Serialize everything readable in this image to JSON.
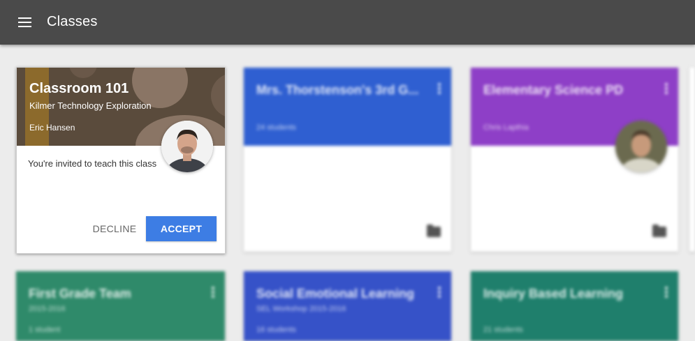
{
  "appbar": {
    "title": "Classes",
    "menu_icon": "hamburger-menu-icon"
  },
  "invite_card": {
    "title": "Classroom 101",
    "subtitle": "Kilmer Technology Exploration",
    "teacher": "Eric Hansen",
    "invite_text": "You're invited to teach this class",
    "decline_label": "DECLINE",
    "accept_label": "ACCEPT",
    "accent_color": "#3d7de4"
  },
  "classes": [
    {
      "title": "Mrs. Thorstenson's 3rd G...",
      "subtitle": "24 students",
      "color": "#2f5fd1"
    },
    {
      "title": "Elementary Science PD",
      "subtitle": "Chris Lapthia",
      "color": "#8e3fc7"
    },
    {
      "title": "First Grade Team",
      "subtitle": "2015-2016",
      "extra": "1 student",
      "color": "#2f8a6a"
    },
    {
      "title": "Social Emotional Learning",
      "subtitle": "SEL Workshop 2015-2016",
      "extra": "16 students",
      "color": "#3652c8"
    },
    {
      "title": "Inquiry Based Learning",
      "extra": "21 students",
      "color": "#1f7f6c"
    }
  ]
}
